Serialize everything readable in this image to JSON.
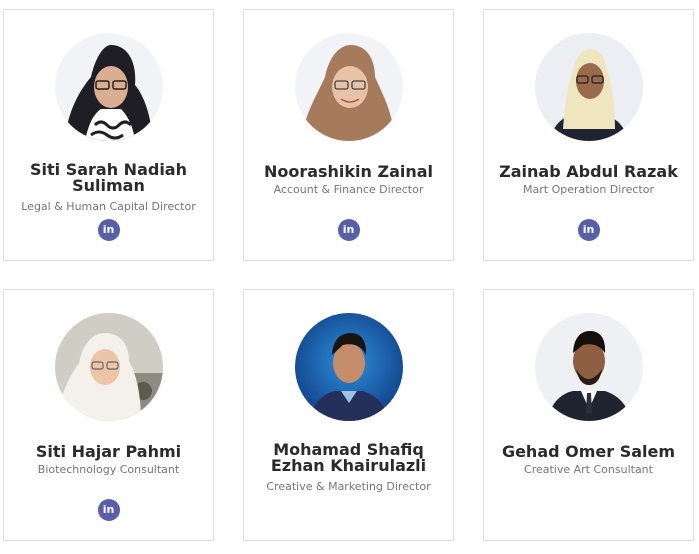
{
  "team": [
    {
      "name": "Siti Sarah Nadiah Suliman",
      "role": "Legal & Human Capital Director",
      "has_linkedin": true,
      "linkedin_icon": "in"
    },
    {
      "name": "Noorashikin Zainal",
      "role": "Account & Finance Director",
      "has_linkedin": true,
      "linkedin_icon": "in"
    },
    {
      "name": "Zainab Abdul Razak",
      "role": "Mart Operation Director",
      "has_linkedin": true,
      "linkedin_icon": "in"
    },
    {
      "name": "Siti Hajar Pahmi",
      "role": "Biotechnology Consultant",
      "has_linkedin": true,
      "linkedin_icon": "in"
    },
    {
      "name": "Mohamad Shafiq Ezhan Khairulazli",
      "role": "Creative & Marketing Director",
      "has_linkedin": false
    },
    {
      "name": "Gehad Omer Salem",
      "role": "Creative Art Consultant",
      "has_linkedin": false
    }
  ],
  "colors": {
    "linkedin_button": "#5a5fa8",
    "card_border": "#e1e1e1",
    "name_text": "#2b2b2b",
    "role_text": "#767676"
  }
}
